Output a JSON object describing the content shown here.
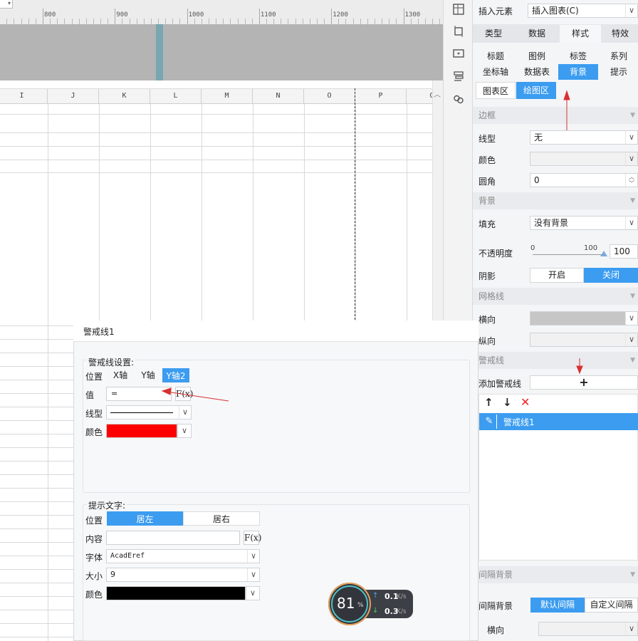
{
  "ruler": {
    "labels": [
      "800",
      "900",
      "1000",
      "1100",
      "1200",
      "1300"
    ]
  },
  "sheet": {
    "columns": [
      "I",
      "J",
      "K",
      "L",
      "M",
      "N",
      "O",
      "P",
      "Q"
    ]
  },
  "toolbar": {
    "icons": [
      "chart-data-icon",
      "crop-frame-icon",
      "dropdown-box-icon",
      "layers-icon",
      "link-icon"
    ]
  },
  "panel": {
    "insert_label": "插入元素",
    "insert_value": "插入图表(C)",
    "main_tabs": [
      "类型",
      "数据",
      "样式",
      "特效"
    ],
    "active_main_tab": "样式",
    "sub_tabs_row1": [
      "标题",
      "图例",
      "标签",
      "系列"
    ],
    "sub_tabs_row2": [
      "坐标轴",
      "数据表",
      "背景",
      "提示"
    ],
    "active_sub_tab": "背景",
    "area_tabs": [
      "图表区",
      "绘图区"
    ],
    "active_area_tab": "绘图区",
    "border_section": "边框",
    "line_type_label": "线型",
    "line_type_value": "无",
    "color_label": "颜色",
    "radius_label": "圆角",
    "radius_value": "0",
    "bg_section": "背景",
    "fill_label": "填充",
    "fill_value": "没有背景",
    "opacity_label": "不透明度",
    "opacity_min": "0",
    "opacity_max": "100",
    "opacity_value": "100",
    "shadow_label": "阴影",
    "shadow_on": "开启",
    "shadow_off": "关闭",
    "grid_section": "网格线",
    "grid_h_label": "横向",
    "grid_v_label": "纵向",
    "alert_section": "警戒线",
    "add_alert_label": "添加警戒线",
    "add_alert_btn": "+",
    "alert_items": [
      "警戒线1"
    ],
    "interval_section": "间隔背景",
    "interval_label": "间隔背景",
    "interval_default": "默认间隔",
    "interval_custom": "自定义间隔",
    "interval_h_label": "横向"
  },
  "dialog": {
    "title": "警戒线1",
    "settings_group": "警戒线设置:",
    "position_label": "位置",
    "axis_options": [
      "X轴",
      "Y轴",
      "Y轴2"
    ],
    "active_axis": "Y轴2",
    "value_label": "值",
    "value_input": "=",
    "fx_label": "F(x)",
    "line_label": "线型",
    "color_label": "颜色",
    "line_color": "#ff0000",
    "hint_group": "提示文字:",
    "hint_pos_label": "位置",
    "hint_left": "居左",
    "hint_right": "居右",
    "content_label": "内容",
    "font_label": "字体",
    "font_value": "AcadEref",
    "size_label": "大小",
    "size_value": "9",
    "text_color_label": "颜色",
    "text_color": "#000000"
  },
  "speed": {
    "percent": "81",
    "unit": "%",
    "up": "0.1",
    "down": "0.3",
    "rate_unit": "K/s"
  },
  "colors": {
    "accent": "#3b9cf0",
    "arrow": "#d9302f"
  }
}
